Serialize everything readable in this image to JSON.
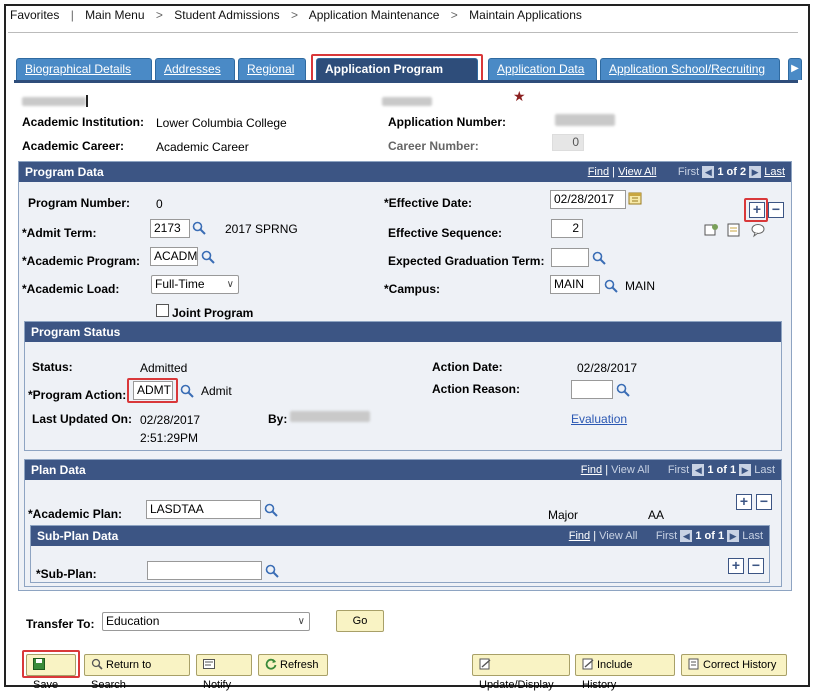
{
  "nav": {
    "favorites": "Favorites",
    "main_menu": "Main Menu",
    "sep": ">",
    "student_admissions": "Student Admissions",
    "application_maintenance": "Application Maintenance",
    "maintain_applications": "Maintain Applications"
  },
  "tabs": [
    {
      "label": "Biographical Details"
    },
    {
      "label": "Addresses"
    },
    {
      "label": "Regional"
    },
    {
      "label": "Application Program Data"
    },
    {
      "label": "Application Data"
    },
    {
      "label": "Application School/Recruiting"
    }
  ],
  "header": {
    "required_star": "★",
    "academic_institution_label": "Academic Institution:",
    "academic_institution_value": "Lower Columbia College",
    "application_number_label": "Application Number:",
    "academic_career_label": "Academic Career:",
    "academic_career_value": "Academic Career",
    "career_number_label": "Career Number:",
    "career_number_value": "0"
  },
  "program_data": {
    "title": "Program Data",
    "find": "Find",
    "view_all": "View All",
    "first": "First",
    "page": "1 of 2",
    "last": "Last",
    "program_number_label": "Program Number:",
    "program_number_value": "0",
    "effective_date_label": "*Effective Date:",
    "effective_date_value": "02/28/2017",
    "admit_term_label": "*Admit Term:",
    "admit_term_value": "2173",
    "admit_term_desc": "2017 SPRNG",
    "effective_sequence_label": "Effective Sequence:",
    "effective_sequence_value": "2",
    "academic_program_label": "*Academic Program:",
    "academic_program_value": "ACADM",
    "expected_grad_label": "Expected Graduation Term:",
    "expected_grad_value": "",
    "academic_load_label": "*Academic Load:",
    "academic_load_value": "Full-Time",
    "campus_label": "*Campus:",
    "campus_value": "MAIN",
    "campus_desc": "MAIN",
    "joint_program_label": "Joint Program"
  },
  "program_status": {
    "title": "Program Status",
    "status_label": "Status:",
    "status_value": "Admitted",
    "action_date_label": "Action Date:",
    "action_date_value": "02/28/2017",
    "program_action_label": "*Program Action:",
    "program_action_value": "ADMT",
    "program_action_desc": "Admit",
    "action_reason_label": "Action Reason:",
    "action_reason_value": "",
    "last_updated_label": "Last Updated On:",
    "last_updated_date": "02/28/2017",
    "last_updated_time": "2:51:29PM",
    "by_label": "By:",
    "evaluation_link": "Evaluation"
  },
  "plan_data": {
    "title": "Plan Data",
    "find": "Find",
    "view_all": "View All",
    "first": "First",
    "page": "1 of 1",
    "last": "Last",
    "academic_plan_label": "*Academic Plan:",
    "academic_plan_value": "LASDTAA",
    "plan_type": "Major",
    "plan_degree": "AA"
  },
  "sub_plan_data": {
    "title": "Sub-Plan Data",
    "find": "Find",
    "view_all": "View All",
    "first": "First",
    "page": "1 of 1",
    "last": "Last",
    "sub_plan_label": "*Sub-Plan:",
    "sub_plan_value": ""
  },
  "transfer": {
    "label": "Transfer To:",
    "value": "Education",
    "go": "Go"
  },
  "toolbar": {
    "save": "Save",
    "return_to_search": "Return to Search",
    "notify": "Notify",
    "refresh": "Refresh",
    "update_display": "Update/Display",
    "include_history": "Include History",
    "correct_history": "Correct History"
  },
  "colors": {
    "header_bar": "#3c5584",
    "tab": "#4a8ac6",
    "highlight": "#d9383a",
    "button": "#f9f3c4"
  }
}
